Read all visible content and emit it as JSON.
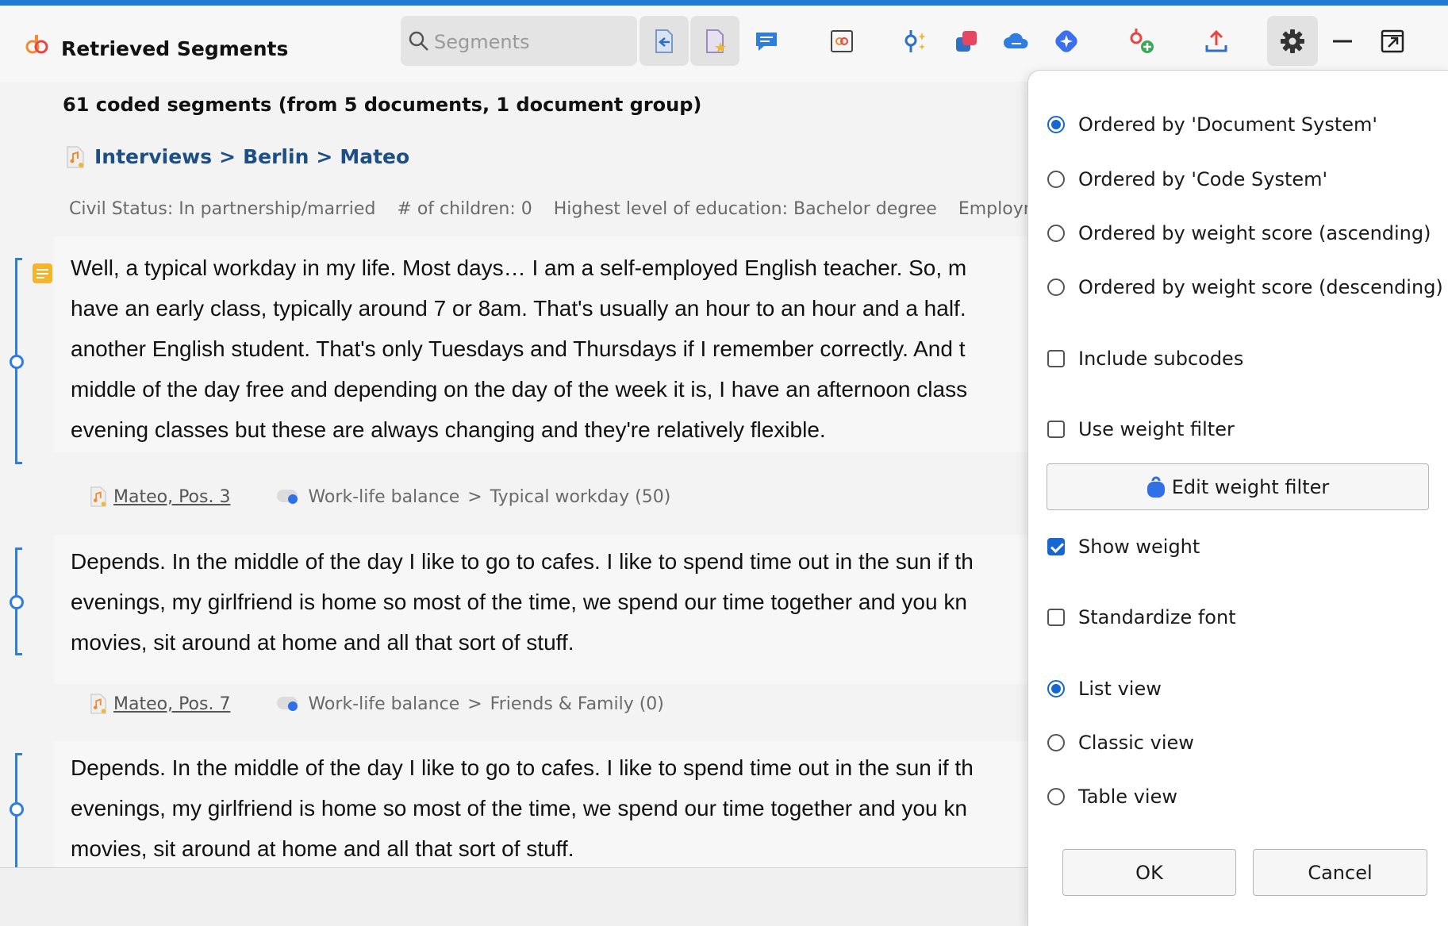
{
  "app": {
    "title": "Retrieved Segments"
  },
  "search": {
    "placeholder": "Segments"
  },
  "toolbar": {
    "icons": [
      "activate-documents-icon",
      "favorite-documents-icon",
      "comment-icon",
      "code-matrix-icon",
      "smart-coding-icon",
      "code-color-icon",
      "cloud-icon",
      "ai-assist-icon",
      "new-code-icon",
      "export-icon",
      "settings-icon",
      "minimize-icon",
      "popout-icon"
    ]
  },
  "summary": "61 coded segments (from 5 documents, 1 document group)",
  "breadcrumb": [
    "Interviews",
    "Berlin",
    "Mateo"
  ],
  "breadcrumb_sep": ">",
  "variables": [
    "Civil Status: In partnership/married",
    "# of children: 0",
    "Highest level of education: Bachelor degree",
    "Employment: Se"
  ],
  "segments": [
    {
      "lines": [
        " Well, a typical workday in my life. Most days… I am a self-employed English teacher. So, m",
        "have an early class, typically around 7 or 8am. That's usually an hour to an hour and a half.",
        "another English student. That's only Tuesdays and Thursdays if I remember correctly. And t",
        "middle of the day free and depending on the day of the week it is, I have an afternoon class",
        "evening classes but these are always changing and they're relatively flexible."
      ],
      "doc": "Mateo, Pos. 3",
      "code_path": "Work-life balance",
      "code_sep": ">",
      "code_name": "Typical workday (50)"
    },
    {
      "lines": [
        "Depends. In the middle of the day I like to go to cafes. I like to spend time out in the sun if th",
        "evenings, my girlfriend is home so most of the time, we spend our time together and you kn",
        "movies, sit around at home and all that sort of stuff."
      ],
      "doc": "Mateo, Pos. 7",
      "code_path": "Work-life balance",
      "code_sep": ">",
      "code_name": "Friends & Family (0)"
    },
    {
      "lines": [
        "Depends. In the middle of the day I like to go to cafes. I like to spend time out in the sun if th",
        "evenings, my girlfriend is home so most of the time, we spend our time together and you kn",
        "movies, sit around at home and all that sort of stuff."
      ]
    }
  ],
  "options": {
    "order_document_system": "Ordered by 'Document System'",
    "order_code_system": "Ordered by 'Code System'",
    "order_weight_asc": "Ordered by weight score (ascending)",
    "order_weight_desc": "Ordered by weight score (descending)",
    "include_subcodes": "Include subcodes",
    "use_weight_filter": "Use weight filter",
    "edit_weight_filter": "Edit weight filter",
    "show_weight": "Show weight",
    "standardize_font": "Standardize font",
    "list_view": "List view",
    "classic_view": "Classic view",
    "table_view": "Table view",
    "ok": "OK",
    "cancel": "Cancel"
  },
  "state": {
    "order": "document_system",
    "include_subcodes": false,
    "use_weight_filter": false,
    "show_weight": true,
    "standardize_font": false,
    "view": "list"
  },
  "colors": {
    "accent": "#1767d2",
    "top_bar": "#1f7ad6",
    "breadcrumb": "#1b4f86",
    "segment_bracket": "#2f7de0"
  }
}
